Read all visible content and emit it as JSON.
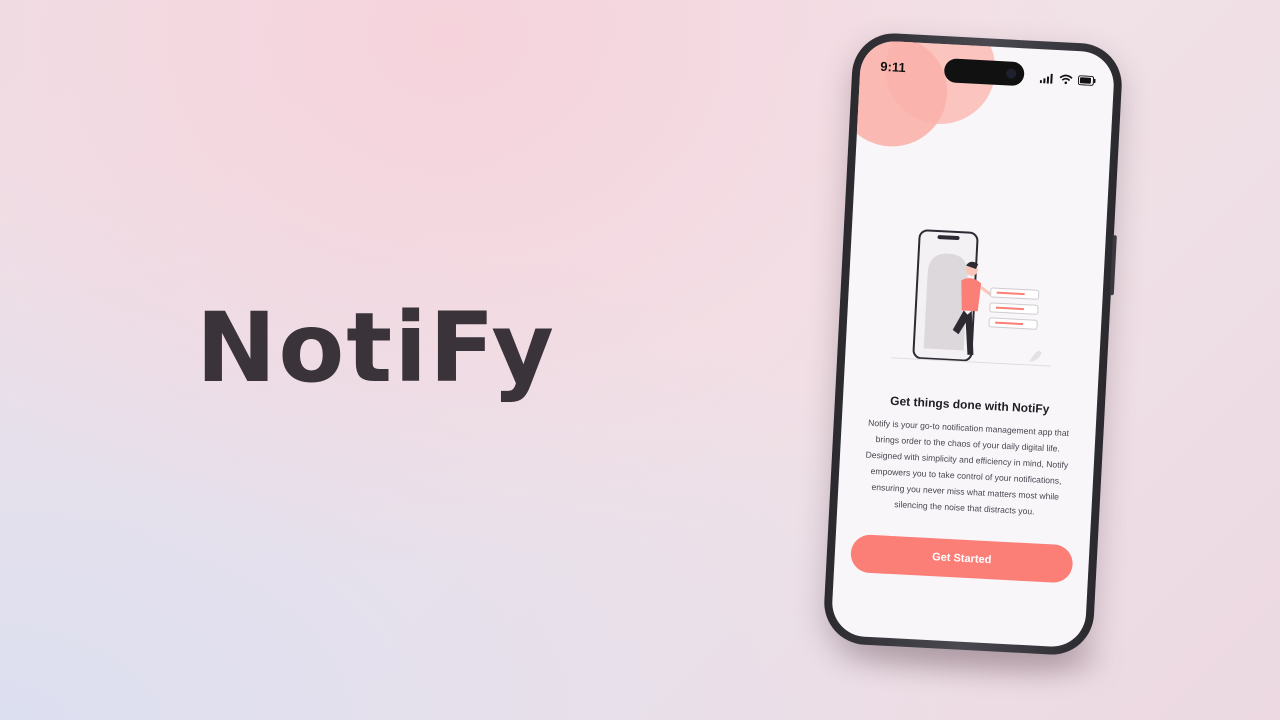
{
  "brand": {
    "title": "NotiFy"
  },
  "status_bar": {
    "time": "9:11"
  },
  "onboarding": {
    "headline": "Get things done with NotiFy",
    "description": "Notify is your go-to notification management app that brings order to the chaos of your daily digital life. Designed with simplicity and efficiency in mind, Notify empowers you to take control of your notifications, ensuring you never miss what matters most while silencing the noise that distracts you.",
    "cta_label": "Get Started"
  },
  "colors": {
    "accent": "#fb7e77",
    "blob": "#fbb3ab",
    "text_dark": "#3a3339",
    "screen_bg": "#f9f6fa"
  },
  "icons": [
    "signal-icon",
    "wifi-icon",
    "battery-icon"
  ]
}
